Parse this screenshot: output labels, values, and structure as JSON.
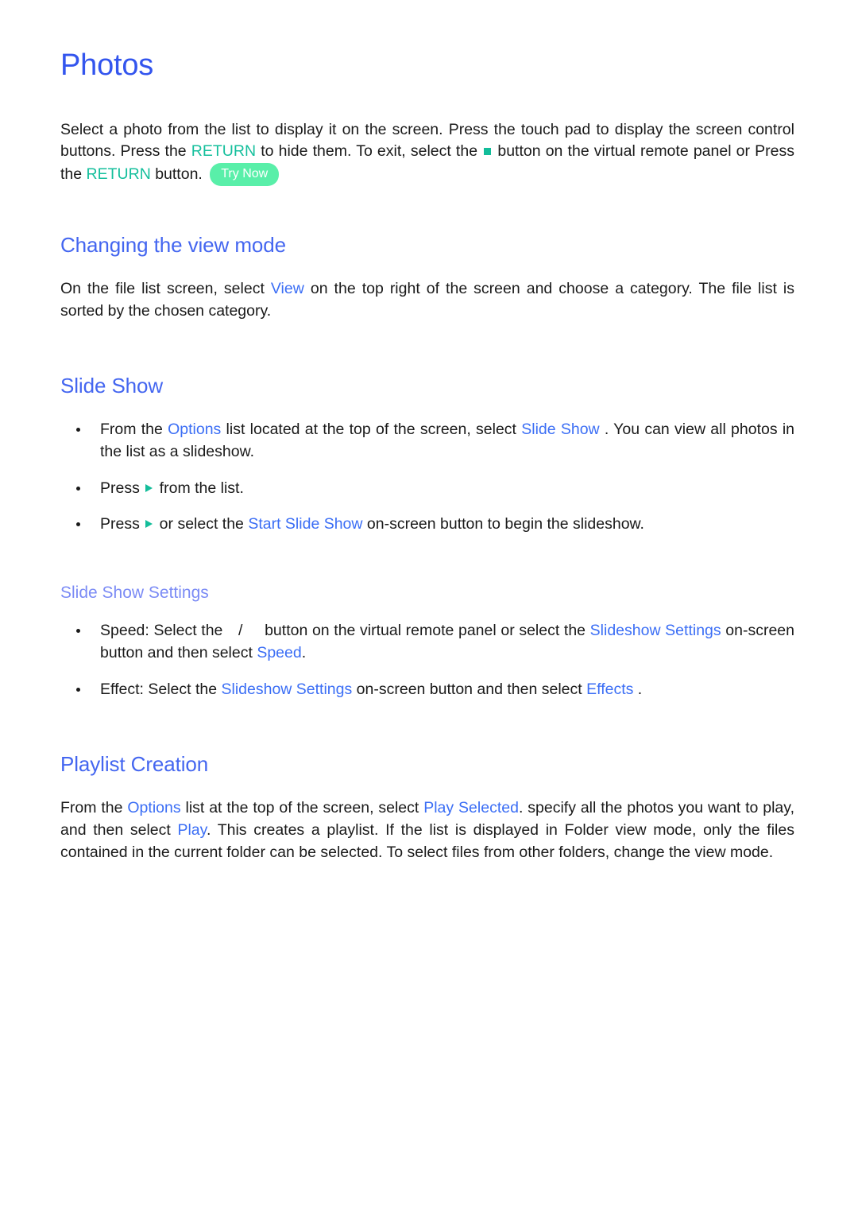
{
  "page": {
    "title": "Photos"
  },
  "intro": {
    "seg1": "Select a photo from the list to display it on the screen. Press the touch pad to display the screen control buttons. Press the ",
    "return1": "RETURN",
    "seg2": " to hide them. To exit, select the ",
    "stop_icon_name": "stop-square-icon",
    "seg3": " button on the virtual remote panel or Press the ",
    "return2": "RETURN",
    "seg4": " button. ",
    "try_now": "Try Now"
  },
  "view_mode": {
    "heading": "Changing the view mode",
    "seg1": "On the file list screen, select ",
    "link_view": "View",
    "seg2": " on the top right of the screen and choose a category. The file list is sorted by the chosen category."
  },
  "slide_show": {
    "heading": "Slide Show",
    "bullets": [
      {
        "seg1": "From the ",
        "link1": "Options",
        "seg2": "  list located at the top of the screen, select ",
        "link2": "Slide Show",
        "seg3": " . You can view all photos in the list as a slideshow."
      },
      {
        "seg1": "Press ",
        "play_icon_name": "play-triangle-icon",
        "seg2": " from the list."
      },
      {
        "seg1": "Press ",
        "play_icon_name": "play-triangle-icon",
        "seg2": " or select the ",
        "link1": "Start Slide Show",
        "seg3": "  on-screen button to begin the slideshow."
      }
    ]
  },
  "slide_show_settings": {
    "heading": "Slide Show Settings",
    "bullets": [
      {
        "seg1": "Speed: Select the ",
        "separator": "/",
        "seg2": " button on the virtual remote panel or select the ",
        "link1": "Slideshow Settings",
        "seg3": "   on-screen button and then select ",
        "link2": "Speed",
        "seg4": "."
      },
      {
        "seg1": "Effect: Select the ",
        "link1": "Slideshow Settings",
        "seg2": "  on-screen button and then select ",
        "link2": "Effects",
        "seg3": " ."
      }
    ]
  },
  "playlist": {
    "heading": "Playlist Creation",
    "seg1": "From the ",
    "link1": "Options",
    "seg2": "  list at the top of the screen, select ",
    "link2": "Play Selected",
    "seg3": ". specify all the photos you want to play, and then select ",
    "link3": "Play",
    "seg4": ". This creates a playlist. If the list is displayed in Folder view mode, only the files contained in the current folder can be selected. To select files from other folders, change the view mode."
  },
  "colors": {
    "title_blue": "#3355ee",
    "heading_blue": "#4466f0",
    "sub_heading_blue": "#7b8bf5",
    "link_blue": "#3b6ef5",
    "key_teal": "#14bf9c",
    "try_now_bg": "#59efa9",
    "body_text": "#1a1a1a"
  }
}
